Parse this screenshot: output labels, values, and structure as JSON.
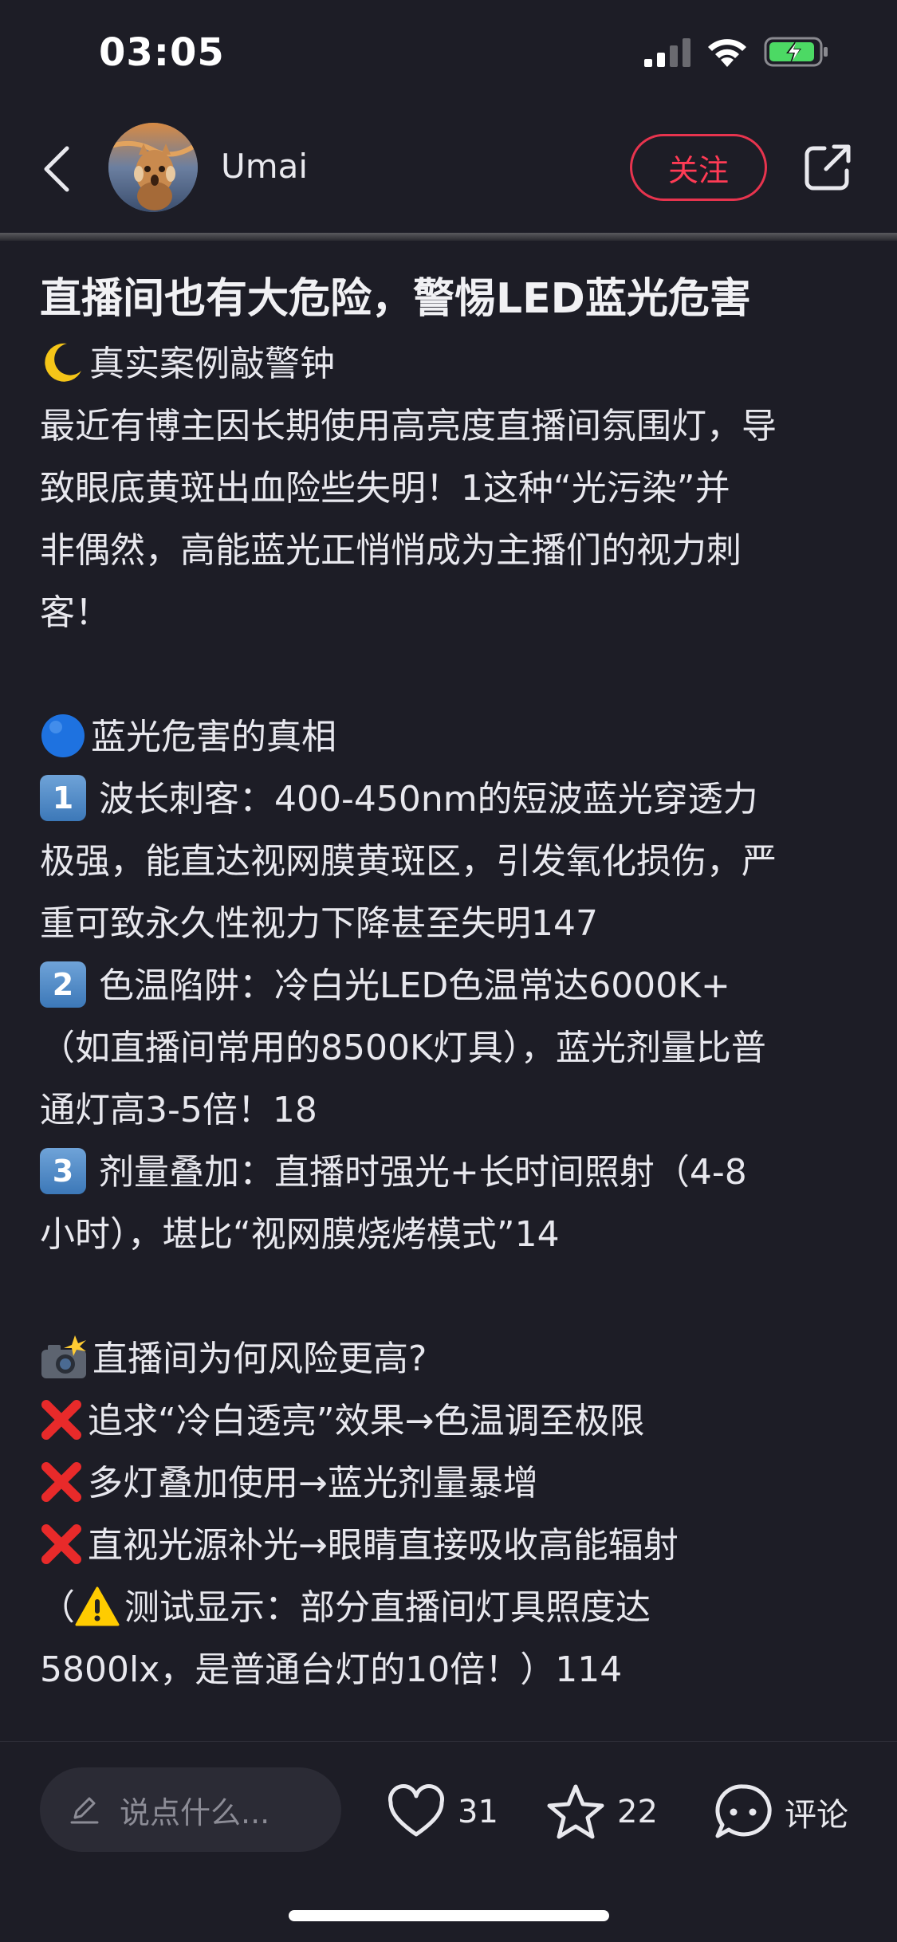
{
  "status": {
    "time": "03:05"
  },
  "header": {
    "username": "Umai",
    "follow_label": "关注"
  },
  "post": {
    "title": "直播间也有大危险，警惕LED蓝光危害",
    "lines": [
      "真实案例敲警钟",
      "最近有博主因长期使用高亮度直播间氛围灯，导",
      "致眼底黄斑出血险些失明！1这种“光污染”并",
      "非偶然，高能蓝光正悄悄成为主播们的视力刺",
      "客！",
      "蓝光危害的真相",
      "波长刺客：400-450nm的短波蓝光穿透力",
      "极强，能直达视网膜黄斑区，引发氧化损伤，严",
      "重可致永久性视力下降甚至失明147",
      "色温陷阱：冷白光LED色温常达6000K+",
      "（如直播间常用的8500K灯具），蓝光剂量比普",
      "通灯高3-5倍！18",
      "剂量叠加：直播时强光+长时间照射（4-8",
      "小时），堪比“视网膜烧烤模式”14",
      "直播间为何风险更高?",
      "追求“冷白透亮”效果→色温调至极限",
      "多灯叠加使用→蓝光剂量暴增",
      "直视光源补光→眼睛直接吸收高能辐射",
      "（",
      "测试显示：部分直播间灯具照度达",
      "5800lx，是普通台灯的10倍！）114"
    ],
    "numbers": [
      "1",
      "2",
      "3"
    ]
  },
  "bottom": {
    "comment_placeholder": "说点什么...",
    "likes": "31",
    "stars": "22",
    "comment_label": "评论"
  }
}
